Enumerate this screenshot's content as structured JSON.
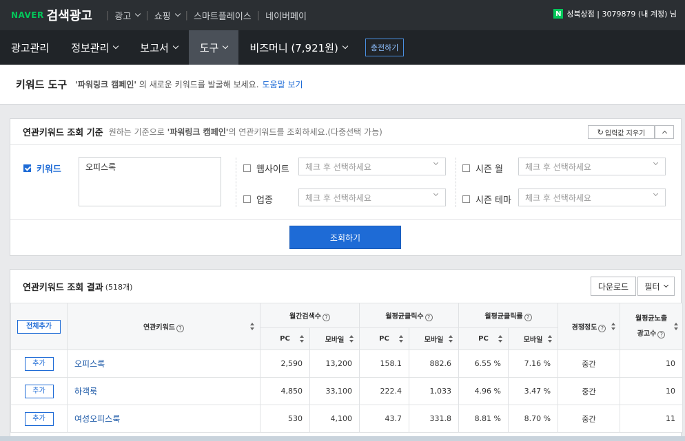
{
  "topbar": {
    "naver": "NAVER",
    "ads": "검색광고",
    "nav": [
      "광고",
      "쇼핑",
      "스마트플레이스",
      "네이버페이"
    ],
    "account_badge": "N",
    "account_text": "성북상점 | 3079879 (내 계정) 님"
  },
  "mainnav": {
    "items": [
      "광고관리",
      "정보관리",
      "보고서",
      "도구",
      "비즈머니 (7,921원)"
    ],
    "charge": "충전하기"
  },
  "titlebar": {
    "title": "키워드 도구",
    "campaign": "'파워링크 캠페인'",
    "desc": "의 새로운 키워드를 발굴해 보세요.",
    "help": "도움말 보기"
  },
  "criteria": {
    "title": "연관키워드 조회 기준",
    "desc_pre": "원하는 기준으로",
    "desc_campaign": "'파워링크 캠페인'",
    "desc_post": "의 연관키워드를 조회하세요.(다중선택 가능)",
    "reset": "입력값 지우기",
    "keyword_label": "키워드",
    "keyword_value": "오피스록",
    "website_label": "웹사이트",
    "industry_label": "업종",
    "season_month_label": "시즌 월",
    "season_theme_label": "시즌 테마",
    "placeholder": "체크 후 선택하세요",
    "search": "조회하기"
  },
  "results": {
    "title": "연관키워드 조회 결과",
    "count": "(518개)",
    "download": "다운로드",
    "filter": "필터",
    "all_add": "전체추가",
    "headers": {
      "keyword": "연관키워드",
      "monthly_search": "월간검색수",
      "avg_clicks": "월평균클릭수",
      "avg_ctr": "월평균클릭률",
      "competition": "경쟁정도",
      "avg_ads_1": "월평균노출",
      "avg_ads_2": "광고수",
      "pc": "PC",
      "mobile": "모바일"
    },
    "add_label": "추가",
    "rows": [
      {
        "keyword": "오피스록",
        "pc_search": "2,590",
        "mo_search": "13,200",
        "pc_click": "158.1",
        "mo_click": "882.6",
        "pc_ctr": "6.55 %",
        "mo_ctr": "7.16 %",
        "competition": "중간",
        "ads": "10"
      },
      {
        "keyword": "하객룩",
        "pc_search": "4,850",
        "mo_search": "33,100",
        "pc_click": "222.4",
        "mo_click": "1,033",
        "pc_ctr": "4.96 %",
        "mo_ctr": "3.47 %",
        "competition": "중간",
        "ads": "10"
      },
      {
        "keyword": "여성오피스룩",
        "pc_search": "530",
        "mo_search": "4,100",
        "pc_click": "43.7",
        "mo_click": "331.8",
        "pc_ctr": "8.81 %",
        "mo_ctr": "8.70 %",
        "competition": "중간",
        "ads": "11"
      }
    ]
  }
}
